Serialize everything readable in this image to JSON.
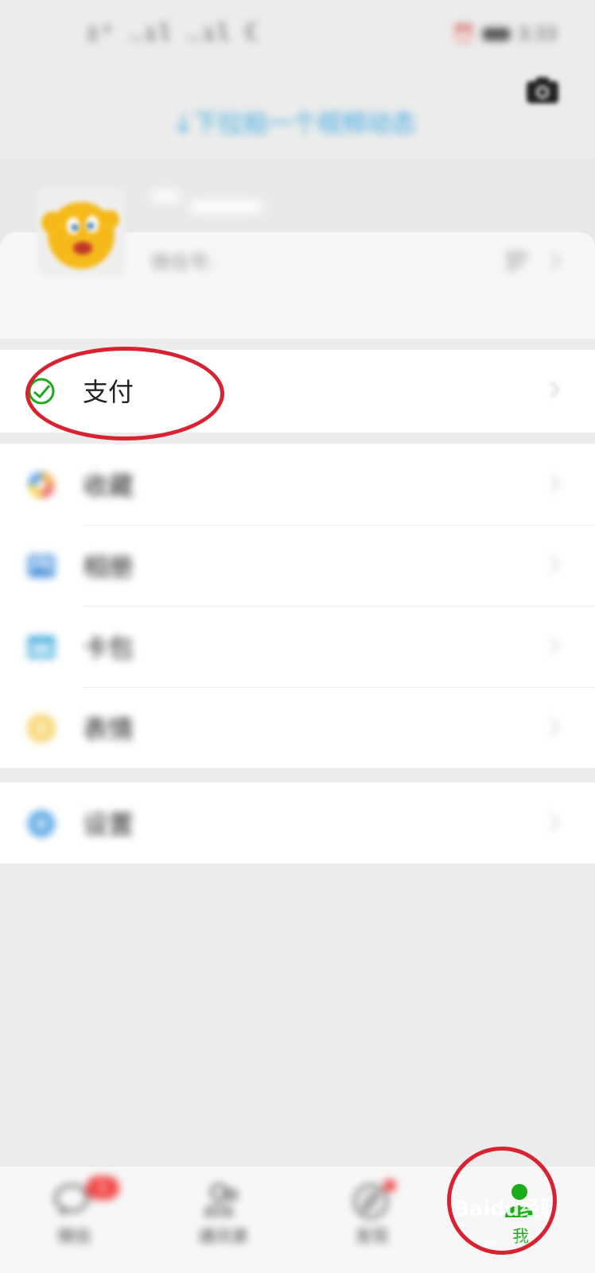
{
  "status_bar": {
    "left_text": "▯ˣ ‥ıl ‥ıl ℂ",
    "right_text": "3:33"
  },
  "header": {
    "pull_hint": "↓下拉拍一个视频动态",
    "camera_icon": "camera-icon"
  },
  "profile": {
    "nickname": "",
    "wechat_id_label": "微信号:",
    "wechat_id_value": "",
    "qr_icon": "qr-code-icon"
  },
  "menu": {
    "pay": {
      "label": "支付",
      "icon": "wechat-pay-icon",
      "color": "#1aad19"
    },
    "favorites": {
      "label": "收藏",
      "icon": "favorites-icon"
    },
    "album": {
      "label": "相册",
      "icon": "album-icon"
    },
    "cards": {
      "label": "卡包",
      "icon": "card-wallet-icon"
    },
    "stickers": {
      "label": "表情",
      "icon": "sticker-icon"
    },
    "settings": {
      "label": "设置",
      "icon": "settings-icon"
    }
  },
  "tabbar": {
    "tabs": [
      {
        "label": "微信",
        "icon": "chat-icon",
        "badge": "1"
      },
      {
        "label": "通讯录",
        "icon": "contacts-icon"
      },
      {
        "label": "发现",
        "icon": "discover-icon",
        "dot": true
      },
      {
        "label": "我",
        "icon": "me-icon",
        "active": true
      }
    ],
    "active_color": "#1aad19"
  },
  "watermark": {
    "brand": "Baidu经验",
    "url": "jingyan.baidu.com"
  },
  "annotation_color": "#d92231"
}
